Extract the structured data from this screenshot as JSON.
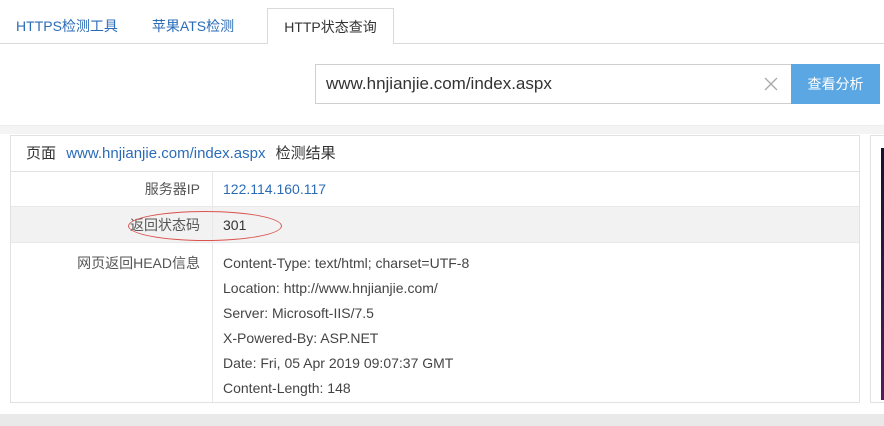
{
  "tabs": [
    {
      "label": "HTTPS检测工具"
    },
    {
      "label": "苹果ATS检测"
    },
    {
      "label": "HTTP状态查询"
    }
  ],
  "search": {
    "value": "www.hnjianjie.com/index.aspx",
    "button_label": "查看分析"
  },
  "result": {
    "prefix": "页面",
    "url": "www.hnjianjie.com/index.aspx",
    "suffix": "检测结果",
    "rows": [
      {
        "label": "服务器IP",
        "value": "122.114.160.117"
      },
      {
        "label": "返回状态码",
        "value": "301"
      },
      {
        "label": "网页返回HEAD信息"
      }
    ],
    "headers": [
      "Content-Type: text/html; charset=UTF-8",
      "Location: http://www.hnjianjie.com/",
      "Server: Microsoft-IIS/7.5",
      "X-Powered-By: ASP.NET",
      "Date: Fri, 05 Apr 2019 09:07:37 GMT",
      "Content-Length: 148"
    ]
  },
  "colors": {
    "link": "#2b6cb8",
    "button": "#5aa7e4",
    "annotation": "#d9534f"
  }
}
